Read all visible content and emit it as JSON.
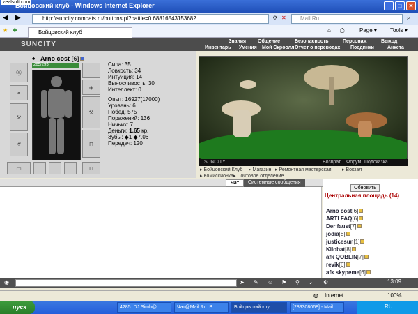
{
  "browser": {
    "watermark": "zealsoft.com",
    "title": "Бойцовский клуб - Windows Internet Explorer",
    "url": "http://suncity.combats.ru/buttons.pl?battle=0.68816543153682",
    "search_placeholder": "Mail.Ru",
    "tab_label": "Бойцовский клуб",
    "tools": [
      "Page ▾",
      "Tools ▾"
    ]
  },
  "game": {
    "logo": "SUNCITY",
    "nav_top": [
      "Знания",
      "Общение",
      "Безопасность",
      "Персонаж",
      "Выход"
    ],
    "nav_bottom": [
      "Инвентарь",
      "Умения",
      "Мой Скроолл",
      "Отчет о переводах",
      "Поединки",
      "Анкета"
    ],
    "character": {
      "name": "Arno cost",
      "level": "[6]",
      "hp": "265/295"
    },
    "stats": [
      "Сила: 35",
      "Ловкость: 34",
      "Интуиция: 14",
      "Выносливость: 30",
      "Интеллект: 0"
    ],
    "exp": [
      "Опыт: 16927(17000)",
      "Уровень: 6",
      "Побед: 575",
      "Поражений: 136",
      "Ничьих: 7"
    ],
    "money_label": "Деньги:",
    "money_value": "1.65",
    "money_unit": "кр.",
    "teeth": "Зубы: ◆1 ◆7.06",
    "transfers": "Передач: 120",
    "scene_bar": {
      "left": "SUNCITY",
      "links": [
        "Возврат",
        "Форум",
        "Подсказка"
      ]
    },
    "links": [
      "Бойцовский Клуб",
      "Магазин",
      "Ремонтная мастерская",
      "Вокзал",
      "Комиссионка",
      "Почтовое отделение"
    ]
  },
  "chat": {
    "tabs": [
      "Чат",
      "Системные сообщения"
    ]
  },
  "online": {
    "refresh_label": "Обновить",
    "location": "Центральная площадь (14)",
    "users": [
      {
        "name": "Arno cost",
        "level": "[6]"
      },
      {
        "name": "ARTI FAQ",
        "level": "[6]"
      },
      {
        "name": "Der faust",
        "level": "[7]"
      },
      {
        "name": "jodia",
        "level": "[8]"
      },
      {
        "name": "justicesun",
        "level": "[1]"
      },
      {
        "name": "Kilobat",
        "level": "[8]"
      },
      {
        "name": "afk QOBLIN",
        "level": "[7]"
      },
      {
        "name": "revik",
        "level": "[6]"
      },
      {
        "name": "afk skypeme",
        "level": "[6]"
      }
    ]
  },
  "clock": "13:09",
  "status": {
    "zone": "Internet",
    "zoom": "100%"
  },
  "taskbar": {
    "start": "пуск",
    "tasks": [
      "4285. DJ Simb@...",
      "Чат@Mail.Ru: В...",
      "Бойцовский клу...",
      "[289308068] - Mail..."
    ],
    "tray_lang": "RU"
  }
}
